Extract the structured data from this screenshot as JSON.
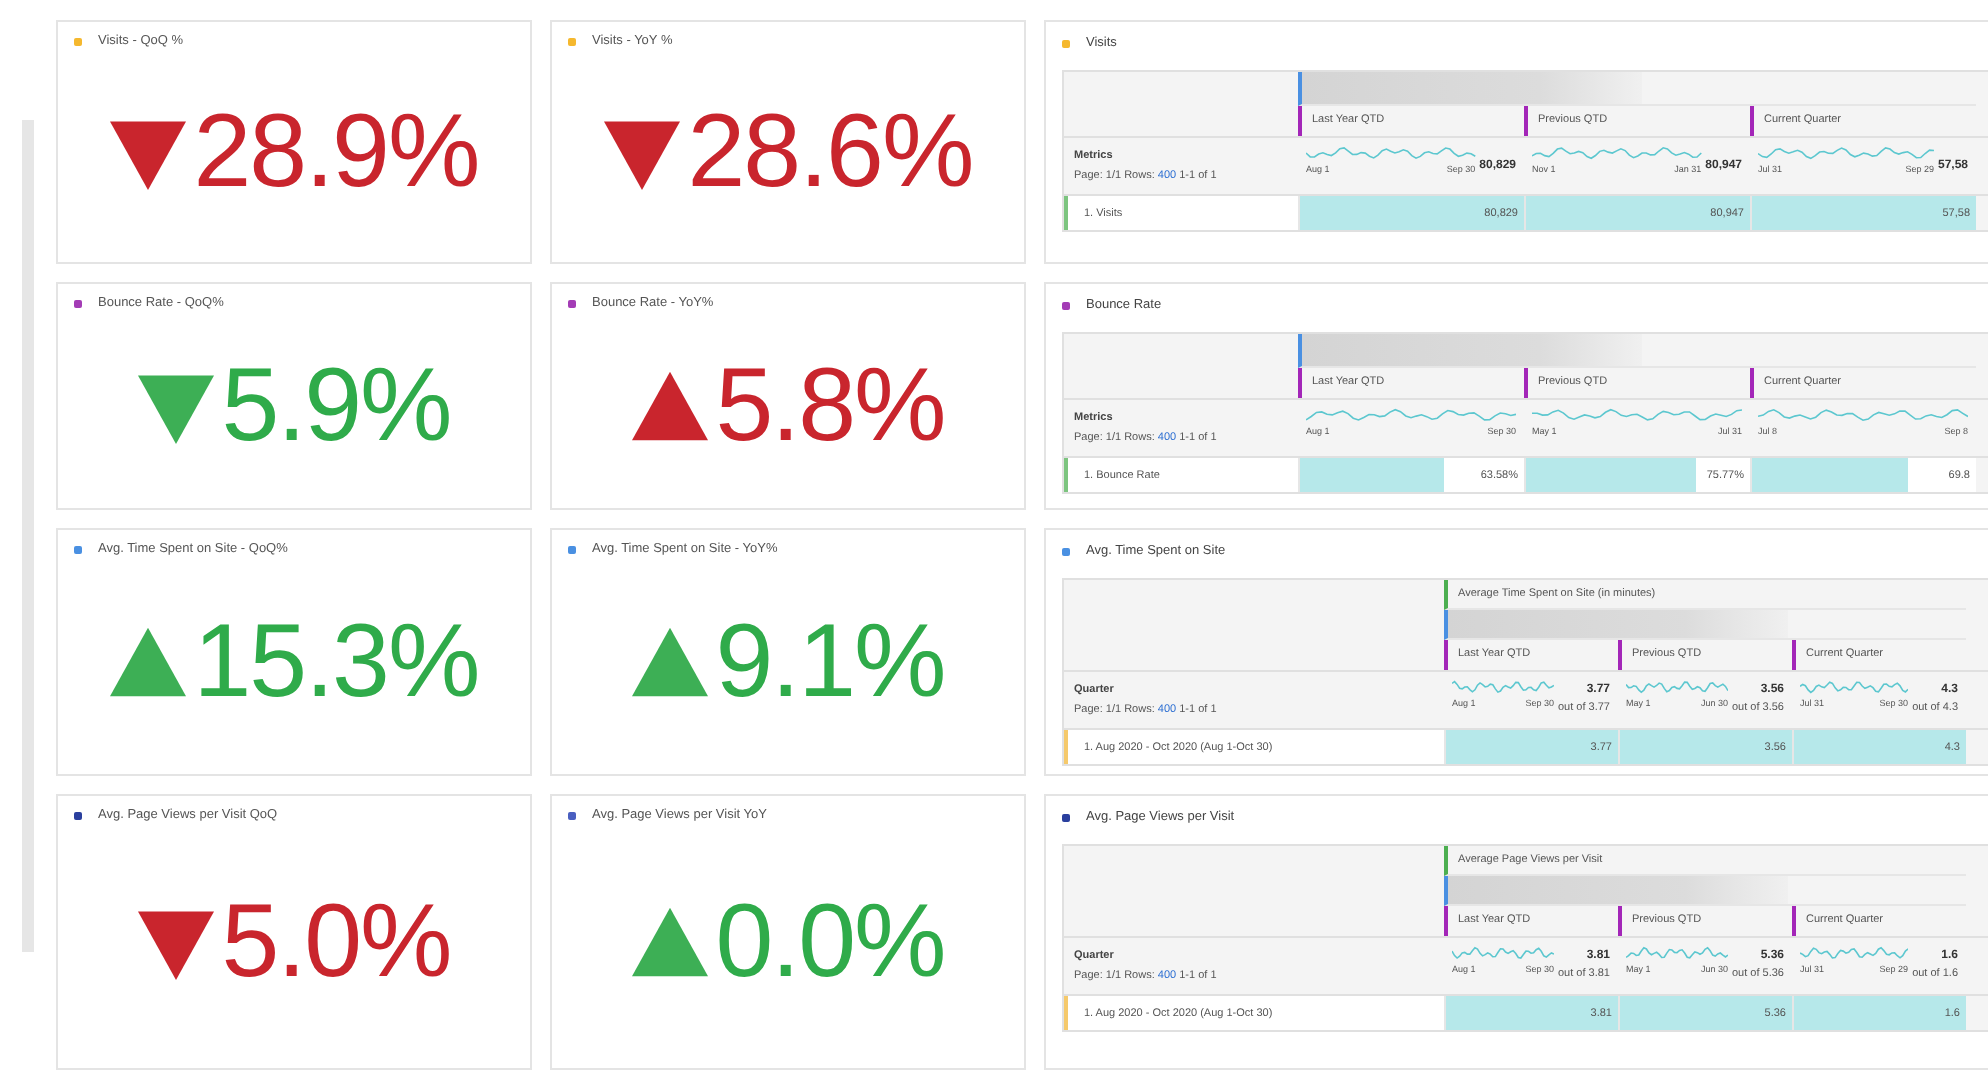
{
  "rows": [
    {
      "kpis": [
        {
          "title": "Visits - QoQ %",
          "color": "#f5b82e",
          "rising": false,
          "favorable": false,
          "value": "28.9%"
        },
        {
          "title": "Visits - YoY %",
          "color": "#f5b82e",
          "rising": false,
          "favorable": false,
          "value": "28.6%"
        }
      ],
      "table": {
        "kind": "metrics",
        "title": "Visits",
        "color": "#f5b82e",
        "headers": [
          "Last Year QTD",
          "Previous QTD",
          "Current Quarter"
        ],
        "dim_label": "Metrics",
        "pager": {
          "prefix": "Page: 1/1 Rows:",
          "rows": "400",
          "range": "1-1 of 1"
        },
        "sparks": [
          {
            "start": "Aug 1",
            "end": "Sep 30",
            "total": "80,829"
          },
          {
            "start": "Nov 1",
            "end": "Jan 31",
            "total": "80,947"
          },
          {
            "start": "Jul 31",
            "end": "Sep 29",
            "total": "57,58"
          }
        ],
        "row": {
          "label": "1. Visits",
          "color": "#7cc47f",
          "cells": [
            {
              "value": "80,829",
              "level": 1
            },
            {
              "value": "80,947",
              "level": 1
            },
            {
              "value": "57,58",
              "level": 1
            }
          ]
        }
      }
    },
    {
      "kpis": [
        {
          "title": "Bounce Rate - QoQ%",
          "color": "#a33cb5",
          "rising": false,
          "favorable": true,
          "value": "5.9%"
        },
        {
          "title": "Bounce Rate - YoY%",
          "color": "#a33cb5",
          "rising": true,
          "favorable": false,
          "value": "5.8%"
        }
      ],
      "table": {
        "kind": "metrics",
        "title": "Bounce Rate",
        "color": "#a33cb5",
        "headers": [
          "Last Year QTD",
          "Previous QTD",
          "Current Quarter"
        ],
        "dim_label": "Metrics",
        "pager": {
          "prefix": "Page: 1/1 Rows:",
          "rows": "400",
          "range": "1-1 of 1"
        },
        "sparks": [
          {
            "start": "Aug 1",
            "end": "Sep 30"
          },
          {
            "start": "May 1",
            "end": "Jul 31"
          },
          {
            "start": "Jul 8",
            "end": "Sep 8"
          }
        ],
        "row": {
          "label": "1. Bounce Rate",
          "color": "#7cc47f",
          "cells": [
            {
              "value": "63.58%",
              "level": 0.64
            },
            {
              "value": "75.77%",
              "level": 0.76
            },
            {
              "value": "69.8",
              "level": 0.7
            }
          ]
        }
      }
    },
    {
      "kpis": [
        {
          "title": "Avg. Time Spent on Site - QoQ%",
          "color": "#4a90e2",
          "rising": true,
          "favorable": true,
          "value": "15.3%"
        },
        {
          "title": "Avg. Time Spent on Site - YoY%",
          "color": "#4a90e2",
          "rising": true,
          "favorable": true,
          "value": "9.1%"
        }
      ],
      "table": {
        "kind": "quarter",
        "title": "Avg. Time Spent on Site",
        "color": "#4a90e2",
        "metric_label": "Average Time Spent on Site (in minutes)",
        "headers": [
          "Last Year QTD",
          "Previous QTD",
          "Current Quarter"
        ],
        "dim_label": "Quarter",
        "pager": {
          "prefix": "Page: 1/1 Rows:",
          "rows": "400",
          "range": "1-1 of 1"
        },
        "sparks": [
          {
            "start": "Aug 1",
            "end": "Sep 30",
            "total": "3.77",
            "sub": "out of 3.77"
          },
          {
            "start": "May 1",
            "end": "Jun 30",
            "total": "3.56",
            "sub": "out of 3.56"
          },
          {
            "start": "Jul 31",
            "end": "Sep 30",
            "total": "4.3",
            "sub": "out of 4.3"
          }
        ],
        "row": {
          "label": "1. Aug 2020 - Oct 2020 (Aug 1-Oct 30)",
          "color": "#f5c96b",
          "cells": [
            {
              "value": "3.77",
              "level": 1
            },
            {
              "value": "3.56",
              "level": 1
            },
            {
              "value": "4.3",
              "level": 1
            }
          ]
        }
      }
    },
    {
      "kpis": [
        {
          "title": "Avg. Page Views per Visit QoQ",
          "color": "#2a3f9e",
          "rising": false,
          "favorable": false,
          "value": "5.0%"
        },
        {
          "title": "Avg. Page Views per Visit YoY",
          "color": "#4a5fc0",
          "rising": true,
          "favorable": true,
          "value": "0.0%"
        }
      ],
      "table": {
        "kind": "quarter",
        "title": "Avg. Page Views per Visit",
        "color": "#2a3f9e",
        "metric_label": "Average Page Views per Visit",
        "headers": [
          "Last Year QTD",
          "Previous QTD",
          "Current Quarter"
        ],
        "dim_label": "Quarter",
        "pager": {
          "prefix": "Page: 1/1 Rows:",
          "rows": "400",
          "range": "1-1 of 1"
        },
        "sparks": [
          {
            "start": "Aug 1",
            "end": "Sep 30",
            "total": "3.81",
            "sub": "out of 3.81"
          },
          {
            "start": "May 1",
            "end": "Jun 30",
            "total": "5.36",
            "sub": "out of 5.36"
          },
          {
            "start": "Jul 31",
            "end": "Sep 29",
            "total": "1.6",
            "sub": "out of 1.6"
          }
        ],
        "row": {
          "label": "1. Aug 2020 - Oct 2020 (Aug 1-Oct 30)",
          "color": "#f5c96b",
          "cells": [
            {
              "value": "3.81",
              "level": 1
            },
            {
              "value": "5.36",
              "level": 1
            },
            {
              "value": "1.6",
              "level": 1
            }
          ]
        }
      }
    }
  ]
}
